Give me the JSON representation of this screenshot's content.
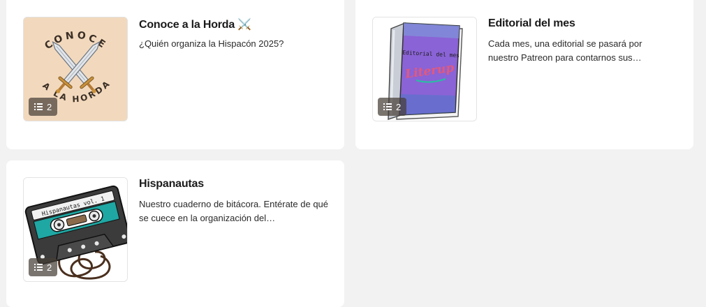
{
  "cards": [
    {
      "title": "Conoce a la Horda ⚔️",
      "description": "¿Quién organiza la Hispacón 2025?",
      "post_count": "2",
      "thumbnail_icon": "crossed-swords-icon",
      "thumbnail_text": [
        "CONOCE",
        "A LA HORDA"
      ],
      "colors": {
        "thumb_bg": "#f2d9bd",
        "ink": "#3a2e25"
      }
    },
    {
      "title": "Editorial del mes",
      "description": "Cada mes, una editorial se pasará por nuestro Patreon para contarnos sus…",
      "post_count": "2",
      "thumbnail_icon": "book-icon",
      "thumbnail_text": [
        "Editorial del mes",
        "Literup"
      ],
      "colors": {
        "cover": "#8a63d6",
        "accent": "#e5587a"
      }
    },
    {
      "title": "Hispanautas",
      "description": "Nuestro cuaderno de bitácora. Entérate de qué se cuece en la organización del…",
      "post_count": "2",
      "thumbnail_icon": "cassette-tape-icon",
      "thumbnail_text": [
        "Hispanautas vol. 1"
      ],
      "colors": {
        "tape_body": "#3b3b3b",
        "tape_stripe": "#1fa7a3"
      }
    }
  ]
}
